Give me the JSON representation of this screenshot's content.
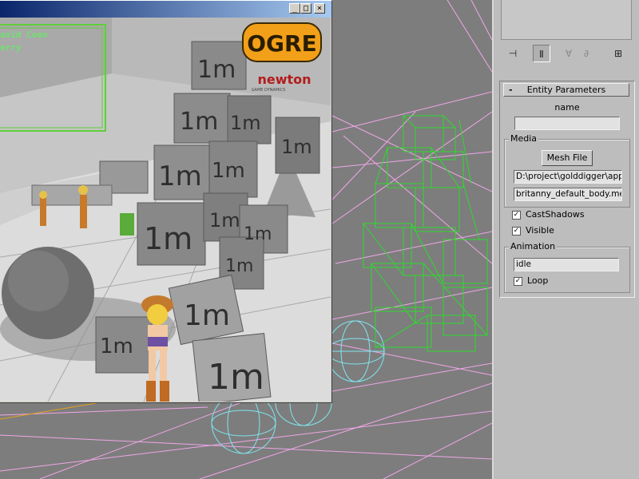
{
  "overlay": {
    "line1": "avid Coen",
    "line2": "erry"
  },
  "ogre_window": {
    "minimize_glyph": "_",
    "maximize_glyph": "□",
    "close_glyph": "×",
    "logo_text": "OGRE",
    "newton_text": "newton",
    "newton_sub": "GAME DYNAMICS",
    "cube_label": "1m"
  },
  "toolbar": {
    "icons": [
      "pin-icon",
      "modifier-stack-icon",
      "funnel-icon",
      "remove-modifier-icon",
      "configure-icon"
    ]
  },
  "entity_params": {
    "header": "Entity Parameters",
    "collapse_glyph": "-",
    "name_label": "name",
    "name_value": "",
    "media_group": "Media",
    "mesh_button": "Mesh File",
    "path_value": "D:\\project\\golddigger\\app",
    "mesh_value": "britanny_default_body.mes",
    "cast_shadows_label": "CastShadows",
    "cast_shadows_checked": true,
    "visible_label": "Visible",
    "visible_checked": true,
    "animation_group": "Animation",
    "animation_value": "idle",
    "loop_label": "Loop",
    "loop_checked": true,
    "check_glyph": "✓"
  },
  "colors": {
    "viewport_bg": "#7d7d7d",
    "wire_green": "#2bdc2b",
    "wire_cyan": "#7fe6ef",
    "wire_pink": "#f0a6e8",
    "panel_bg": "#bdbdbd"
  }
}
